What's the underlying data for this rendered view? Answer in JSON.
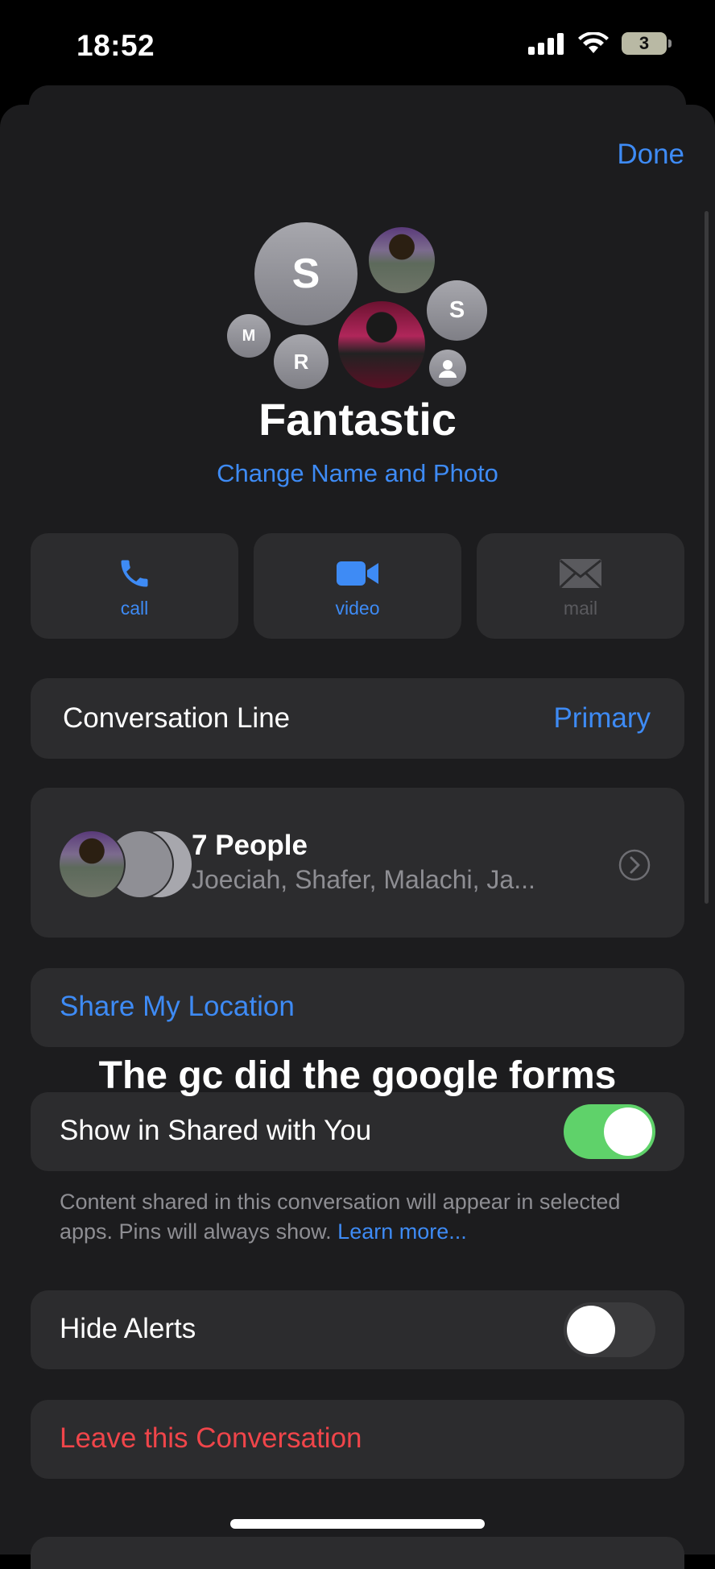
{
  "status": {
    "time": "18:52",
    "battery": "3"
  },
  "header": {
    "done_label": "Done"
  },
  "group": {
    "avatars": [
      "S",
      "M",
      "R",
      "S"
    ],
    "name": "Fantastic",
    "change_link": "Change Name and Photo"
  },
  "actions": [
    {
      "label": "call",
      "icon": "phone-icon",
      "enabled": true
    },
    {
      "label": "video",
      "icon": "video-camera-icon",
      "enabled": true
    },
    {
      "label": "mail",
      "icon": "envelope-icon",
      "enabled": false
    }
  ],
  "conversation_line": {
    "label": "Conversation Line",
    "value": "Primary"
  },
  "people": {
    "title": "7 People",
    "names": "Joeciah, Shafer, Malachi, Ja..."
  },
  "share_location": {
    "label": "Share My Location"
  },
  "caption": "The gc did the google forms",
  "shared_with_you": {
    "label": "Show in Shared with You",
    "enabled": true,
    "footnote": "Content shared in this conversation will appear in selected apps. Pins will always show.",
    "learn_more": "Learn more..."
  },
  "hide_alerts": {
    "label": "Hide Alerts",
    "enabled": false
  },
  "leave": {
    "label": "Leave this Conversation"
  },
  "colors": {
    "accent": "#3e8bf5",
    "destructive": "#f0454a",
    "toggle_on": "#5fd26a",
    "toggle_off": "#3a3a3c",
    "card": "#2c2c2e"
  }
}
